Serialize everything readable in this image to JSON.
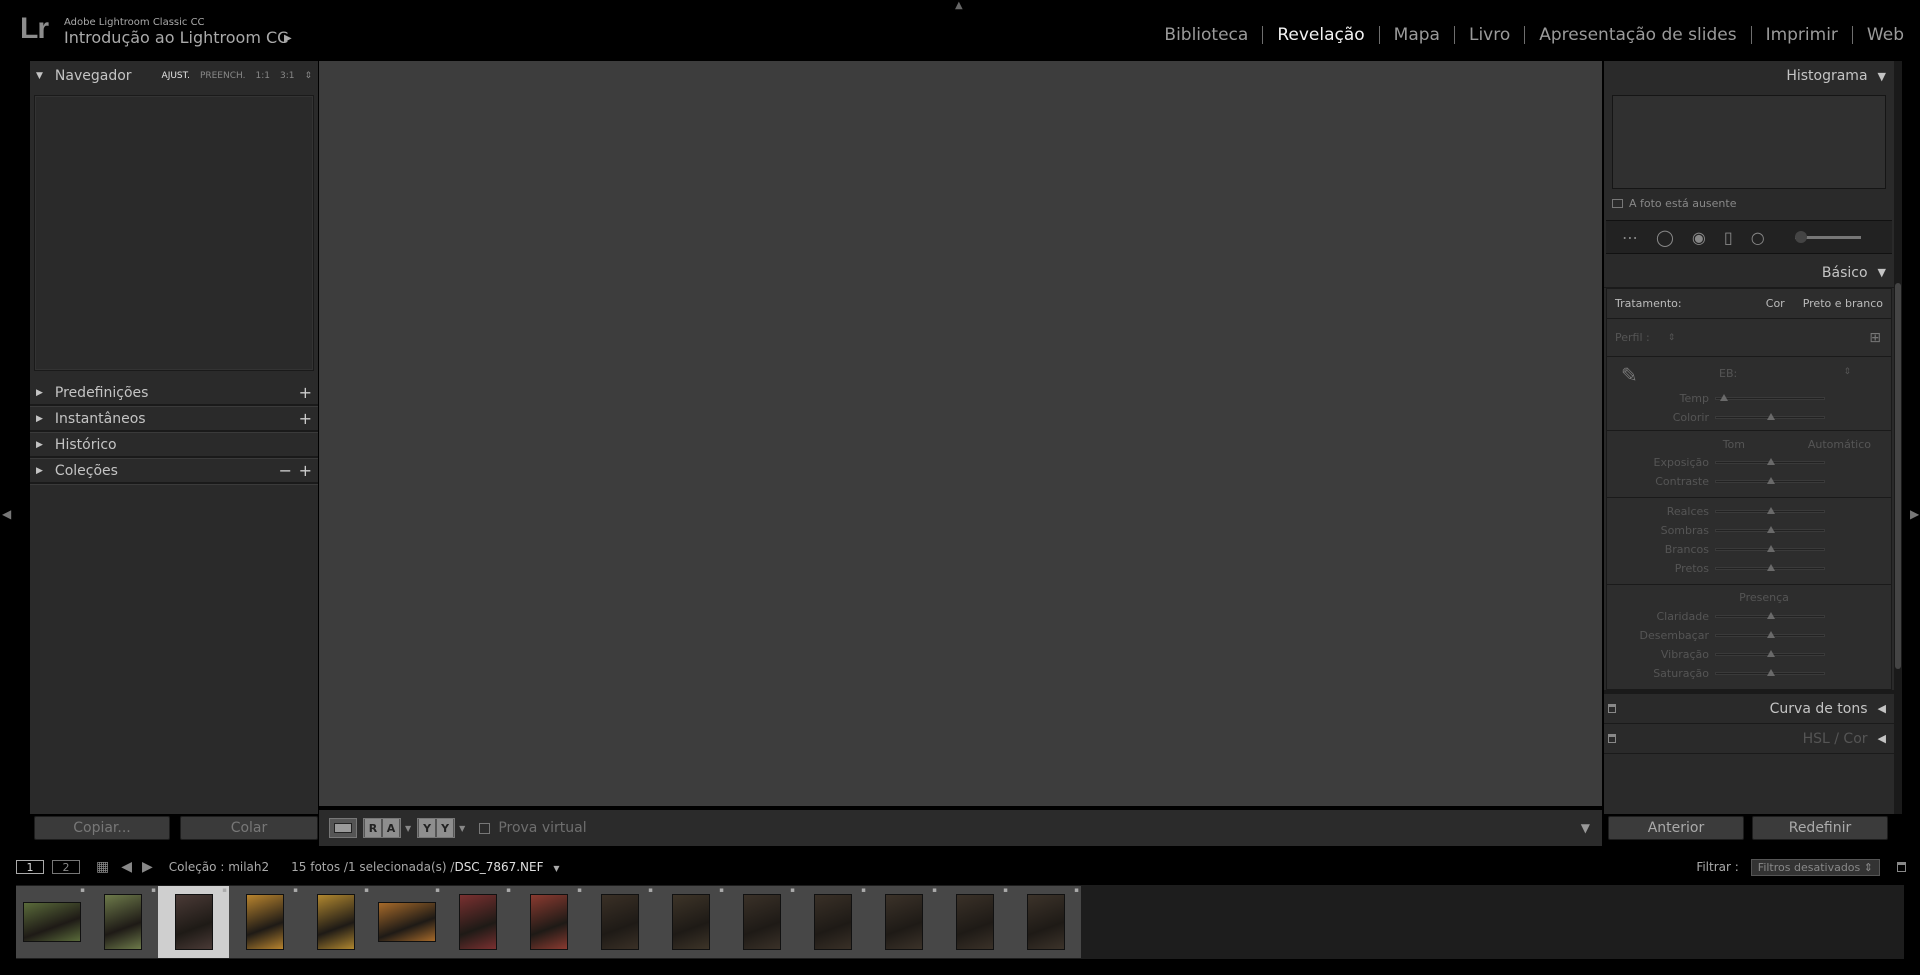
{
  "identity": {
    "logo": "Lr",
    "product": "Adobe Lightroom Classic CC",
    "catalog": "Introdução ao Lightroom CC"
  },
  "modules": [
    "Biblioteca",
    "Revelação",
    "Mapa",
    "Livro",
    "Apresentação de slides",
    "Imprimir",
    "Web"
  ],
  "active_module": "Revelação",
  "left": {
    "navigator": {
      "title": "Navegador",
      "options": [
        "AJUST.",
        "PREENCH.",
        "1:1",
        "3:1"
      ],
      "active_option": "AJUST."
    },
    "panels": [
      {
        "title": "Predefinições",
        "actions": [
          "+"
        ]
      },
      {
        "title": "Instantâneos",
        "actions": [
          "+"
        ]
      },
      {
        "title": "Histórico",
        "actions": []
      },
      {
        "title": "Coleções",
        "actions": [
          "−",
          "+"
        ]
      }
    ],
    "buttons": {
      "copy": "Copiar...",
      "paste": "Colar"
    }
  },
  "toolbar": {
    "pair1": [
      "R",
      "A"
    ],
    "pair2": [
      "Y",
      "Y"
    ],
    "soft_proof": "Prova virtual"
  },
  "right": {
    "histogram": {
      "title": "Histograma",
      "status": "A foto está ausente"
    },
    "basic": {
      "title": "Básico",
      "treatment_label": "Tratamento:",
      "treatment_options": [
        "Cor",
        "Preto e branco"
      ],
      "profile_label": "Perfil :",
      "wb_label": "EB:",
      "wb_sliders": [
        {
          "label": "Temp",
          "value": 0.05
        },
        {
          "label": "Colorir",
          "value": 0.5
        }
      ],
      "tone_label": "Tom",
      "auto_label": "Automático",
      "tone_sliders": [
        {
          "label": "Exposição",
          "value": 0.5
        },
        {
          "label": "Contraste",
          "value": 0.5
        }
      ],
      "tone_sliders2": [
        {
          "label": "Realces",
          "value": 0.5
        },
        {
          "label": "Sombras",
          "value": 0.5
        },
        {
          "label": "Brancos",
          "value": 0.5
        },
        {
          "label": "Pretos",
          "value": 0.5
        }
      ],
      "presence_label": "Presença",
      "presence_sliders": [
        {
          "label": "Claridade",
          "value": 0.5
        },
        {
          "label": "Desembaçar",
          "value": 0.5
        },
        {
          "label": "Vibração",
          "value": 0.5
        },
        {
          "label": "Saturação",
          "value": 0.5
        }
      ]
    },
    "tone_curve": "Curva de tons",
    "hsl": "HSL / Cor",
    "buttons": {
      "previous": "Anterior",
      "reset": "Redefinir"
    }
  },
  "filmstrip_bar": {
    "screen1": "1",
    "screen2": "2",
    "collection": "Coleção : milah2",
    "count": "15 fotos /1 selecionada(s) /",
    "file": "DSC_7867.NEF",
    "filter_label": "Filtrar :",
    "filter_value": "Filtros desativados"
  },
  "thumbnails": [
    {
      "orientation": "landscape",
      "color": "#5a6b3a",
      "selected": false
    },
    {
      "orientation": "portrait",
      "color": "#6d7a4a",
      "selected": false
    },
    {
      "orientation": "portrait",
      "color": "#4a3a36",
      "selected": true
    },
    {
      "orientation": "portrait",
      "color": "#b8842e",
      "selected": false
    },
    {
      "orientation": "portrait",
      "color": "#b0872f",
      "selected": false
    },
    {
      "orientation": "landscape",
      "color": "#a66a2a",
      "selected": false
    },
    {
      "orientation": "portrait",
      "color": "#7a3030",
      "selected": false
    },
    {
      "orientation": "portrait",
      "color": "#8a3a30",
      "selected": false
    },
    {
      "orientation": "portrait",
      "color": "#3a3026",
      "selected": false
    },
    {
      "orientation": "portrait",
      "color": "#3d3428",
      "selected": false
    },
    {
      "orientation": "portrait",
      "color": "#3a3128",
      "selected": false
    },
    {
      "orientation": "portrait",
      "color": "#393027",
      "selected": false
    },
    {
      "orientation": "portrait",
      "color": "#3b3229",
      "selected": false
    },
    {
      "orientation": "portrait",
      "color": "#3a3128",
      "selected": false
    },
    {
      "orientation": "portrait",
      "color": "#3c332a",
      "selected": false
    }
  ]
}
